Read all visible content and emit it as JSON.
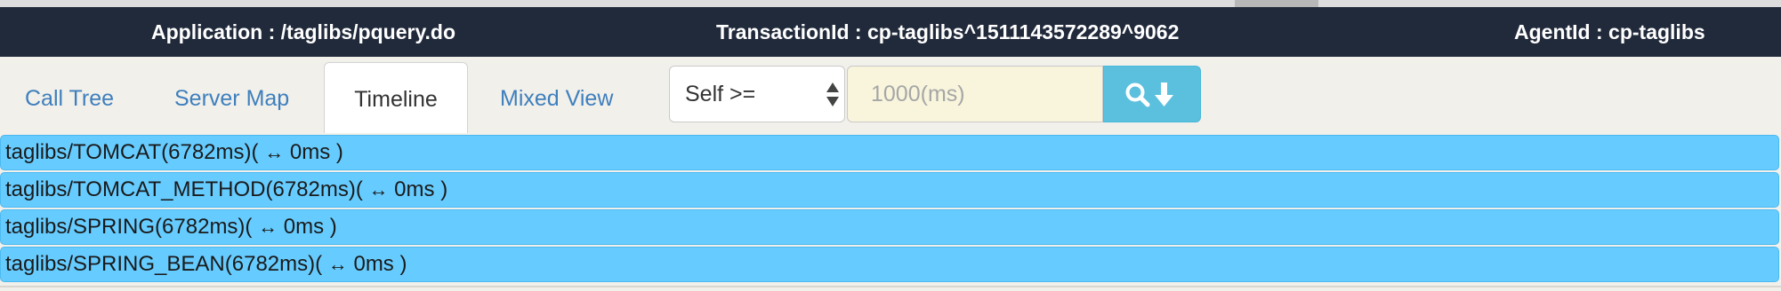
{
  "header": {
    "application": "Application : /taglibs/pquery.do",
    "transaction_id": "TransactionId : cp-taglibs^1511143572289^9062",
    "agent_id": "AgentId : cp-taglibs"
  },
  "tabs": [
    {
      "label": "Call Tree",
      "active": false
    },
    {
      "label": "Server Map",
      "active": false
    },
    {
      "label": "Timeline",
      "active": true
    },
    {
      "label": "Mixed View",
      "active": false
    }
  ],
  "filter": {
    "select_value": "Self >=",
    "input_placeholder": "1000(ms)",
    "search_icon": "search-icon",
    "download_icon": "arrow-down-icon"
  },
  "timeline_rows": [
    {
      "label": "taglibs/TOMCAT(6782ms)( ",
      "arrow": "↔",
      "duration": " 0ms )"
    },
    {
      "label": "taglibs/TOMCAT_METHOD(6782ms)( ",
      "arrow": "↔",
      "duration": " 0ms )"
    },
    {
      "label": "taglibs/SPRING(6782ms)( ",
      "arrow": "↔",
      "duration": " 0ms )"
    },
    {
      "label": "taglibs/SPRING_BEAN(6782ms)( ",
      "arrow": "↔",
      "duration": " 0ms )"
    }
  ],
  "colors": {
    "header_bg": "#212a3b",
    "row_bg": "#66ccff",
    "tab_link": "#3e7fbd",
    "search_button": "#5bc0de",
    "input_bg": "#f8f5dc"
  }
}
